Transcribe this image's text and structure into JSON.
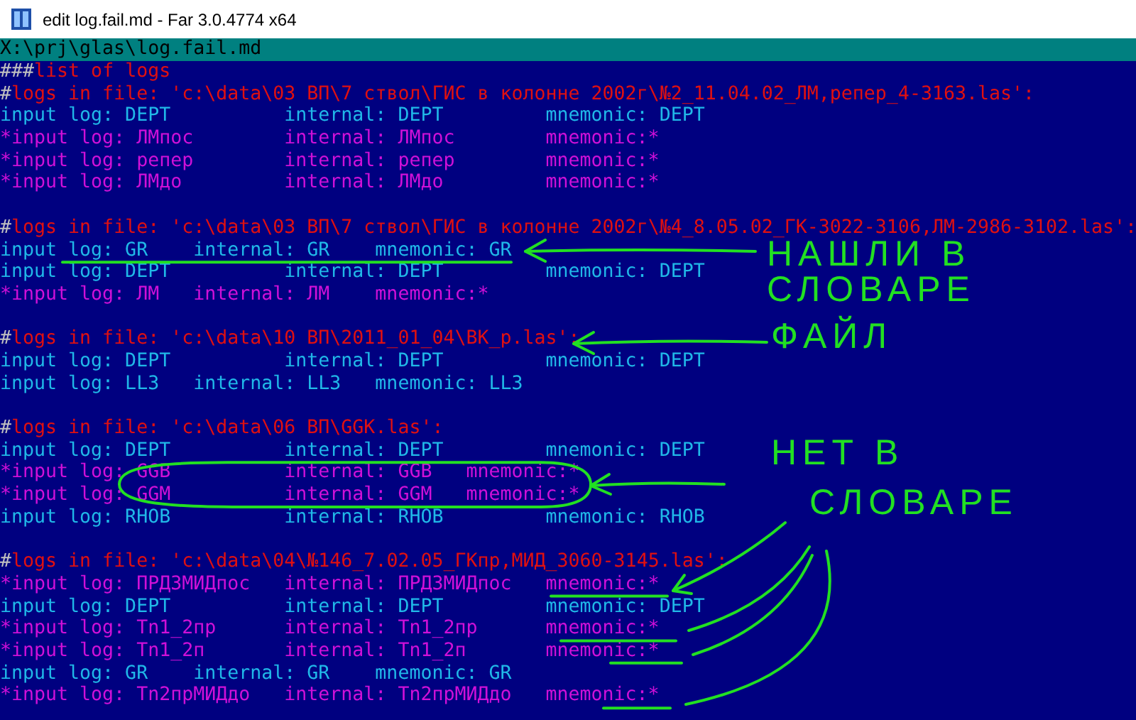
{
  "window": {
    "title": "edit log.fail.md - Far 3.0.4774 x64"
  },
  "path_bar": {
    "path": "X:\\prj\\glas\\log.fail.md"
  },
  "lines": [
    {
      "kind": "heading",
      "marker": "###",
      "text": "list of logs"
    },
    {
      "kind": "heading",
      "marker": "#",
      "text": "logs in file: 'c:\\data\\03 ВП\\7 ствол\\ГИС в колонне 2002г\\№2_11.04.02_ЛМ,репер_4-3163.las':"
    },
    {
      "kind": "found",
      "text": "input log: DEPT          internal: DEPT         mnemonic: DEPT"
    },
    {
      "kind": "missing",
      "text": "*input log: ЛМпос        internal: ЛМпос        mnemonic:*"
    },
    {
      "kind": "missing",
      "text": "*input log: репер        internal: репер        mnemonic:*"
    },
    {
      "kind": "missing",
      "text": "*input log: ЛМдо         internal: ЛМдо         mnemonic:*"
    },
    {
      "kind": "blank"
    },
    {
      "kind": "heading",
      "marker": "#",
      "text": "logs in file: 'c:\\data\\03 ВП\\7 ствол\\ГИС в колонне 2002г\\№4_8.05.02_ГК-3022-3106,ЛМ-2986-3102.las':"
    },
    {
      "kind": "found",
      "text": "input log: GR    internal: GR    mnemonic: GR"
    },
    {
      "kind": "found",
      "text": "input log: DEPT          internal: DEPT         mnemonic: DEPT"
    },
    {
      "kind": "missing",
      "text": "*input log: ЛМ   internal: ЛМ    mnemonic:*"
    },
    {
      "kind": "blank"
    },
    {
      "kind": "heading",
      "marker": "#",
      "text": "logs in file: 'c:\\data\\10 ВП\\2011_01_04\\ВК_p.las':"
    },
    {
      "kind": "found",
      "text": "input log: DEPT          internal: DEPT         mnemonic: DEPT"
    },
    {
      "kind": "found",
      "text": "input log: LL3   internal: LL3   mnemonic: LL3"
    },
    {
      "kind": "blank"
    },
    {
      "kind": "heading",
      "marker": "#",
      "text": "logs in file: 'c:\\data\\06 ВП\\GGK.las':"
    },
    {
      "kind": "found",
      "text": "input log: DEPT          internal: DEPT         mnemonic: DEPT"
    },
    {
      "kind": "missing",
      "text": "*input log: GGB          internal: GGB   mnemonic:*"
    },
    {
      "kind": "missing",
      "text": "*input log: GGM          internal: GGM   mnemonic:*"
    },
    {
      "kind": "found",
      "text": "input log: RHOB          internal: RHOB         mnemonic: RHOB"
    },
    {
      "kind": "blank"
    },
    {
      "kind": "heading",
      "marker": "#",
      "text": "logs in file: 'c:\\data\\04\\№146_7.02.05_ГКпр,МИД_3060-3145.las':"
    },
    {
      "kind": "missing",
      "text": "*input log: ПРДЗМИДпос   internal: ПРДЗМИДпос   mnemonic:*"
    },
    {
      "kind": "found",
      "text": "input log: DEPT          internal: DEPT         mnemonic: DEPT"
    },
    {
      "kind": "missing",
      "text": "*input log: Tn1_2пр      internal: Tn1_2пр      mnemonic:*"
    },
    {
      "kind": "missing",
      "text": "*input log: Tn1_2п       internal: Tn1_2п       mnemonic:*"
    },
    {
      "kind": "found",
      "text": "input log: GR    internal: GR    mnemonic: GR"
    },
    {
      "kind": "missing",
      "text": "*input log: Tn2прМИДдо   internal: Tn2прМИДдо   mnemonic:*"
    }
  ],
  "annotations": [
    {
      "text": "НАШЛИ В"
    },
    {
      "text": "СЛОВАРЕ"
    },
    {
      "text": "ФАЙЛ"
    },
    {
      "text": "НЕТ В"
    },
    {
      "text": "СЛОВАРЕ"
    }
  ]
}
